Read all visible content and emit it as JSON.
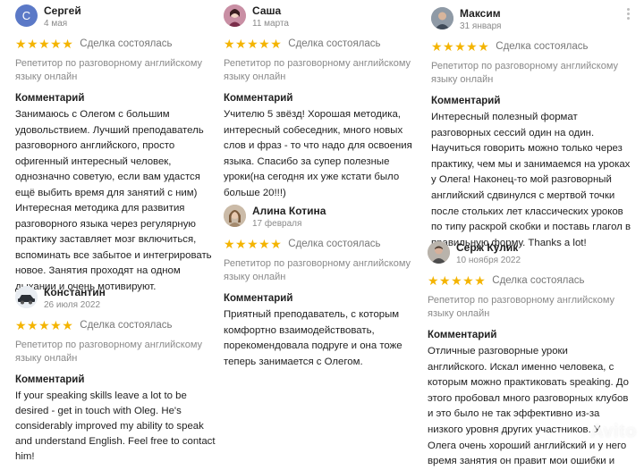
{
  "colors": {
    "star": "#f4b400",
    "avatar_letter_bg": "#5b79c7"
  },
  "labels": {
    "deal": "Сделка состоялась",
    "comment": "Комментарий",
    "stars": "★★★★★"
  },
  "reviews": [
    {
      "avatar_letter": "С",
      "name": "Сергей",
      "date": "4 мая",
      "rating": 5,
      "service": "Репетитор по разговорному английскому языку онлайн",
      "comment": "Занимаюсь с Олегом с большим удовольствием. Лучший преподаватель разговорного английского, просто офигенный интересный человек, однозначно советую, если вам удастся ещё выбить время для занятий с ним) Интересная методика для развития разговорного языка через регулярную практику заставляет мозг включиться, вспоминать все забытое и интегрировать новое. Занятия проходят на одном дыхании и очень мотивируют."
    },
    {
      "avatar_letter": "",
      "name": "Константин",
      "date": "26 июля 2022",
      "rating": 5,
      "service": "Репетитор по разговорному английскому языку онлайн",
      "comment": "If your speaking skills leave a lot to be desired - get in touch with Oleg. He's considerably improved my ability to speak and understand English. Feel free to contact him!"
    },
    {
      "avatar_letter": "",
      "name": "Саша",
      "date": "11 марта",
      "rating": 5,
      "service": "Репетитор по разговорному английскому языку онлайн",
      "comment": "Учителю 5 звёзд! Хорошая методика, интересный собеседник, много новых слов и фраз - то что надо для освоения языка. Спасибо за супер полезные уроки(на сегодня их уже кстати было больше 20!!!)"
    },
    {
      "avatar_letter": "",
      "name": "Алина Котина",
      "date": "17 февраля",
      "rating": 5,
      "service": "Репетитор по разговорному английскому языку онлайн",
      "comment": "Приятный преподаватель, с которым комфортно взаимодействовать, порекомендовала подруге и она тоже теперь занимается с Олегом."
    },
    {
      "avatar_letter": "",
      "name": "Максим",
      "date": "31 января",
      "rating": 5,
      "service": "Репетитор по разговорному английскому языку онлайн",
      "comment": "Интересный полезный формат разговорных сессий один на один. Научиться говорить можно только через практику, чем мы и занимаемся на уроках у Олега! Наконец-то мой разговорный английский сдвинулся с мертвой точки после стольких лет классических уроков по типу раскрой скобки и поставь глагол в правильную форму. Thanks a lot!"
    },
    {
      "avatar_letter": "",
      "name": "Серж Кулик",
      "date": "10 ноября 2022",
      "rating": 5,
      "service": "Репетитор по разговорному английскому языку онлайн",
      "comment": "Отличные разговорные уроки английского. Искал именно человека, с которым можно практиковать speaking. До этого пробовал много разговорных клубов и это было не так эффективно из-за низкого уровня других участников. У Олега очень хороший английский и у него время занятия он правит мои ошибки и"
    }
  ],
  "watermark": "Avito"
}
